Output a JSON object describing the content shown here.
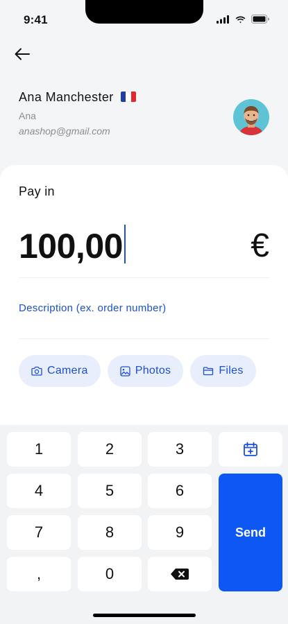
{
  "status_bar": {
    "time": "9:41"
  },
  "recipient": {
    "name": "Ana Manchester",
    "flag": "france-flag",
    "nickname": "Ana",
    "email": "anashop@gmail.com",
    "avatar": "avatar-photo"
  },
  "payment": {
    "label": "Pay in",
    "amount": "100,00",
    "currency": "€",
    "description_placeholder": "Description (ex. order number)"
  },
  "attachments": [
    {
      "label": "Camera",
      "icon": "camera-icon"
    },
    {
      "label": "Photos",
      "icon": "image-icon"
    },
    {
      "label": "Files",
      "icon": "folder-icon"
    }
  ],
  "keypad": {
    "keys": [
      "1",
      "2",
      "3",
      "4",
      "5",
      "6",
      "7",
      "8",
      "9",
      ",",
      "0"
    ],
    "schedule_icon": "calendar-add-icon",
    "backspace_icon": "backspace-icon",
    "send_label": "Send"
  },
  "colors": {
    "accent": "#0d58f5",
    "link": "#1a4fdc",
    "chip_bg": "#e8eefb",
    "background": "#f4f5f7"
  }
}
